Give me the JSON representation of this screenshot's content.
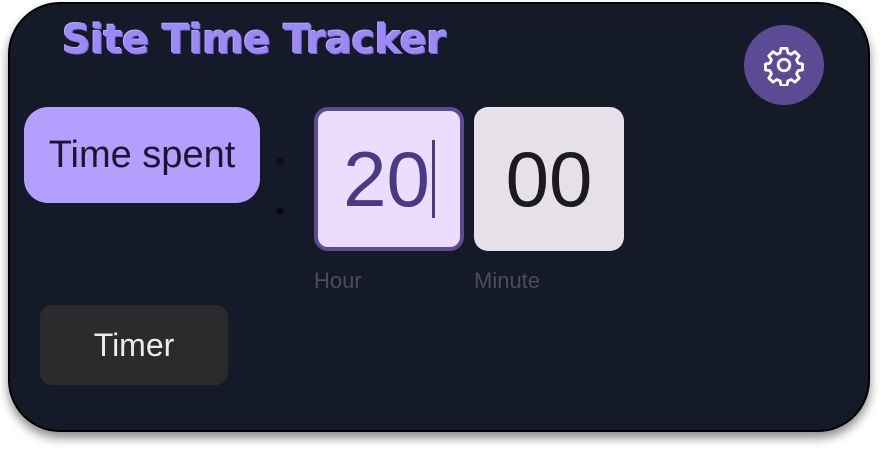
{
  "app": {
    "title": "Site Time Tracker"
  },
  "settings_button": {
    "icon": "gear-icon"
  },
  "mode_button": {
    "label": "Time spent"
  },
  "time_input": {
    "hour_value": "20",
    "minute_value": "00",
    "hour_label": "Hour",
    "minute_label": "Minute",
    "separator": ":"
  },
  "timer_button": {
    "label": "Timer"
  },
  "colors": {
    "background": "#141a28",
    "accent": "#b39ffe",
    "accent_dark": "#5c4b94",
    "title": "#9c89f5"
  }
}
